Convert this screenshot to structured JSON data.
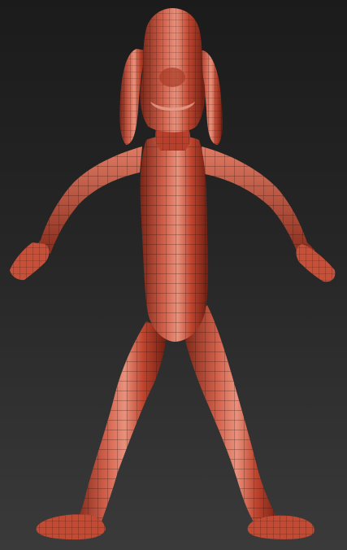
{
  "viewport": {
    "background_top": "#1b1b1b",
    "background_bottom": "#3a3a3a"
  },
  "model": {
    "subject": "character-mesh",
    "material_colors": {
      "base": "#c0442d",
      "highlight": "#e88a74",
      "shadow": "#6e1e12",
      "wire": "#2a0b06"
    }
  }
}
